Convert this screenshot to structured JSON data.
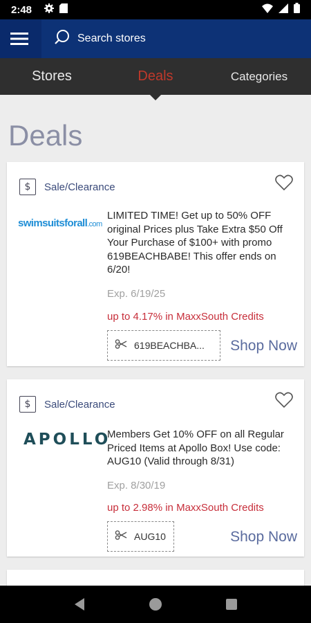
{
  "status_bar": {
    "time": "2:48",
    "icons": [
      "gear-icon",
      "sd-card-icon",
      "wifi-icon",
      "signal-icon",
      "battery-icon"
    ]
  },
  "app_bar": {
    "menu_icon": "hamburger-menu-icon",
    "search_icon": "search-icon",
    "search_placeholder": "Search stores"
  },
  "tabs": [
    {
      "label": "Stores",
      "active": false
    },
    {
      "label": "Deals",
      "active": true
    },
    {
      "label": "Categories",
      "active": false
    }
  ],
  "page_title": "Deals",
  "deals": [
    {
      "category": "Sale/Clearance",
      "store": {
        "logo_main": "swimsuitsforall",
        "logo_suffix": ".com"
      },
      "description": "LIMITED TIME! Get up to 50% OFF original Prices plus Take Extra $50 Off Your Purchase of $100+ with promo 619BEACHBABE! This offer ends on 6/20!",
      "expiration": "Exp. 6/19/25",
      "credits": "up to 4.17% in MaxxSouth Credits",
      "coupon_code": "619BEACHBA...",
      "shop_label": "Shop Now"
    },
    {
      "category": "Sale/Clearance",
      "store": {
        "logo_main": "APOLLO",
        "logo_suffix": ""
      },
      "description": "Members Get 10% OFF on all Regular Priced Items at Apollo Box! Use code: AUG10 (Valid through 8/31)",
      "expiration": "Exp. 8/30/19",
      "credits": "up to 2.98% in MaxxSouth Credits",
      "coupon_code": "AUG10",
      "shop_label": "Shop Now"
    }
  ],
  "colors": {
    "app_bar": "#0a2a6b",
    "tab_bar": "#2f2f2f",
    "active_tab": "#c0392b",
    "credits": "#c72e3a",
    "shop_now": "#5a6b9e"
  }
}
